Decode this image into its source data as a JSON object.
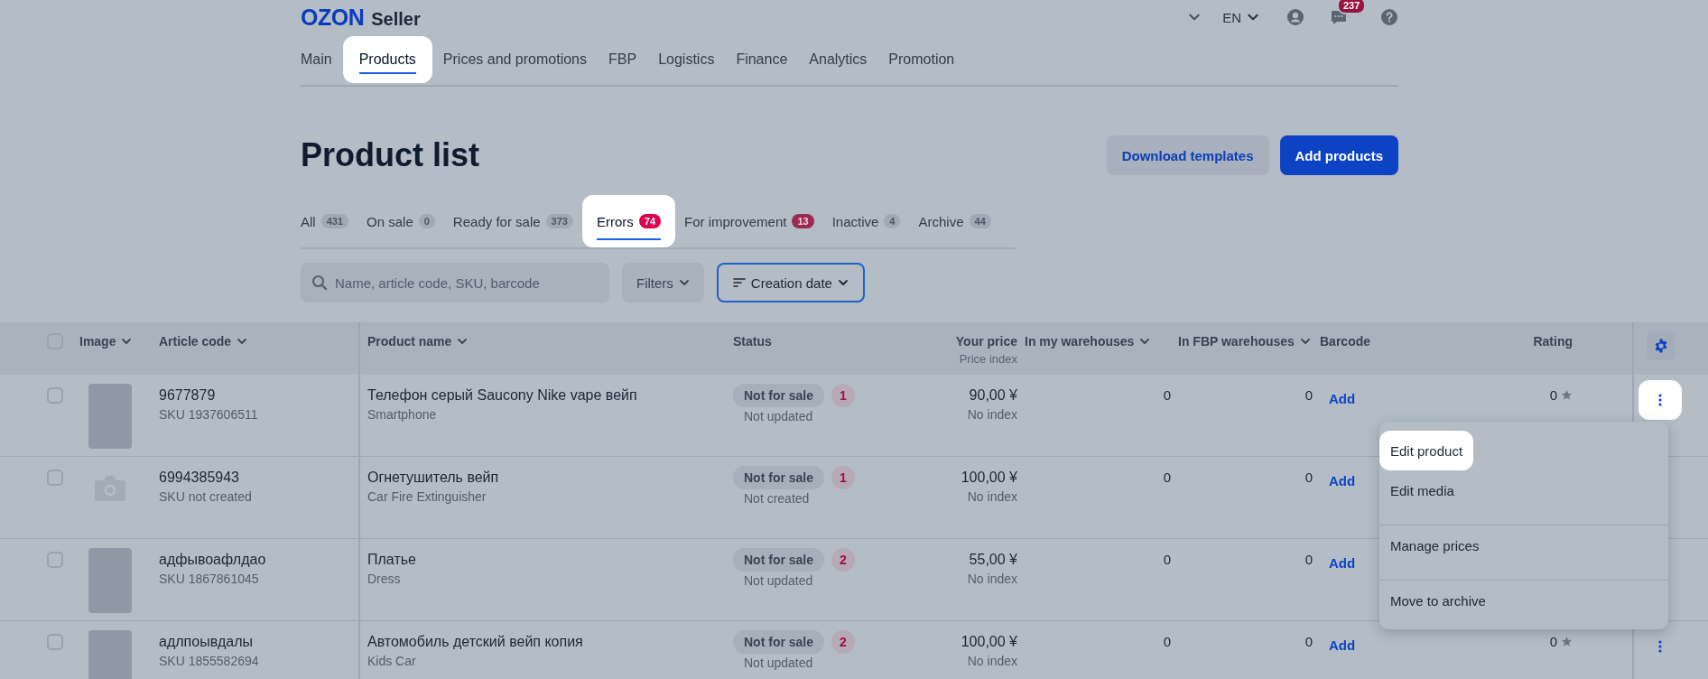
{
  "header": {
    "logo": {
      "brand": "OZON",
      "product": "Seller"
    },
    "language": "EN",
    "chat_badge": "237"
  },
  "nav": [
    {
      "label": "Main",
      "selected": false,
      "highlighted": false
    },
    {
      "label": "Products",
      "selected": true,
      "highlighted": true
    },
    {
      "label": "Prices and promotions",
      "selected": false,
      "highlighted": false
    },
    {
      "label": "FBP",
      "selected": false,
      "highlighted": false
    },
    {
      "label": "Logistics",
      "selected": false,
      "highlighted": false
    },
    {
      "label": "Finance",
      "selected": false,
      "highlighted": false
    },
    {
      "label": "Analytics",
      "selected": false,
      "highlighted": false
    },
    {
      "label": "Promotion",
      "selected": false,
      "highlighted": false
    }
  ],
  "page_title": "Product list",
  "actions": [
    {
      "label": "Download templates",
      "kind": "secondary"
    },
    {
      "label": "Add products",
      "kind": "primary"
    }
  ],
  "tabs": [
    {
      "label": "All",
      "count": "431",
      "alert": false,
      "selected": false,
      "highlighted": false
    },
    {
      "label": "On sale",
      "count": "0",
      "alert": false,
      "selected": false,
      "highlighted": false
    },
    {
      "label": "Ready for sale",
      "count": "373",
      "alert": false,
      "selected": false,
      "highlighted": false
    },
    {
      "label": "Errors",
      "count": "74",
      "alert": true,
      "selected": true,
      "highlighted": true
    },
    {
      "label": "For improvement",
      "count": "13",
      "alert": true,
      "selected": false,
      "highlighted": false
    },
    {
      "label": "Inactive",
      "count": "4",
      "alert": false,
      "selected": false,
      "highlighted": false
    },
    {
      "label": "Archive",
      "count": "44",
      "alert": false,
      "selected": false,
      "highlighted": false
    }
  ],
  "search": {
    "placeholder": "Name, article code, SKU, barcode"
  },
  "filters": {
    "label": "Filters"
  },
  "sort": {
    "label": "Creation date"
  },
  "table": {
    "select_all": {
      "checked": false
    },
    "columns": [
      {
        "label": "Image",
        "sortable": true
      },
      {
        "label": "Article code",
        "sortable": true
      },
      {
        "label": "Product name",
        "sortable": true
      },
      {
        "label": "Status",
        "sortable": false
      },
      {
        "label": "Your price",
        "sublabel": "Price index",
        "sortable": false
      },
      {
        "label": "In my warehouses",
        "sortable": true
      },
      {
        "label": "In FBP warehouses",
        "sortable": true
      },
      {
        "label": "Barcode",
        "sortable": false
      },
      {
        "label": "Rating",
        "sortable": false
      }
    ],
    "rows": [
      {
        "checked": false,
        "kind": "photo",
        "article": "9677879",
        "sku": "SKU 1937606511",
        "name": "Телефон серый Saucony Nike vape вейп",
        "category": "Smartphone",
        "status": "Not for sale",
        "errors": "1",
        "status_note": "Not updated",
        "price": "90,00 ¥",
        "price_index": "No index",
        "my_warehouses": "0",
        "fbp_warehouses": "0",
        "barcode": "Add",
        "rating": "0",
        "menu_button": {
          "highlighted": true
        }
      },
      {
        "checked": false,
        "kind": "none",
        "article": "6994385943",
        "sku": "SKU not created",
        "name": "Огнетушитель вейп",
        "category": "Car Fire Extinguisher",
        "status": "Not for sale",
        "errors": "1",
        "status_note": "Not created",
        "price": "100,00 ¥",
        "price_index": "No index",
        "my_warehouses": "0",
        "fbp_warehouses": "0",
        "barcode": "Add"
      },
      {
        "checked": false,
        "kind": "photo",
        "article": "адфывоафлдао",
        "sku": "SKU 1867861045",
        "name": "Платье",
        "category": "Dress",
        "status": "Not for sale",
        "errors": "2",
        "status_note": "Not updated",
        "price": "55,00 ¥",
        "price_index": "No index",
        "my_warehouses": "0",
        "fbp_warehouses": "0",
        "barcode": "Add"
      },
      {
        "checked": false,
        "kind": "photo",
        "article": "адлпоывдалы",
        "sku": "SKU 1855582694",
        "name": "Автомобиль детский вейп копия",
        "category": "Kids Car",
        "status": "Not for sale",
        "errors": "2",
        "status_note": "Not updated",
        "price": "100,00 ¥",
        "price_index": "No index",
        "my_warehouses": "0",
        "fbp_warehouses": "0",
        "barcode": "Add",
        "rating": "0",
        "menu_button": {
          "highlighted": false
        }
      }
    ]
  },
  "row_menu": {
    "items": [
      {
        "label": "Edit product",
        "separated": false,
        "highlighted": true
      },
      {
        "label": "Edit media",
        "separated": false,
        "highlighted": false
      },
      {
        "label": "Manage prices",
        "separated": true,
        "highlighted": false
      },
      {
        "label": "Move to archive",
        "separated": true,
        "highlighted": false
      }
    ]
  }
}
